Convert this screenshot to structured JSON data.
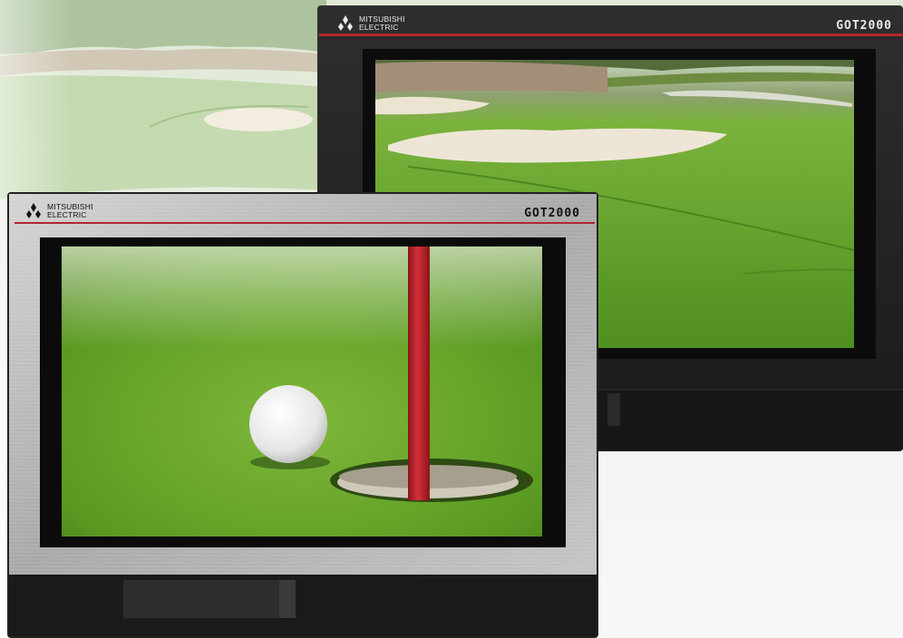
{
  "back_unit": {
    "brand_line1": "MITSUBISHI",
    "brand_line2": "ELECTRIC",
    "model": "GOT2000",
    "bezel_color": "#232323",
    "accent_stripe": "#b3262a"
  },
  "front_unit": {
    "brand_line1": "MITSUBISHI",
    "brand_line2": "ELECTRIC",
    "model": "GOT2000",
    "bezel_color": "#b8b8b8",
    "accent_stripe": "#b3262a"
  },
  "colors": {
    "grass": "#5f9a2a",
    "sand": "#e9e0cc",
    "flag_pole": "#c4242a"
  },
  "icons": [
    "mitsubishi-three-diamonds-logo"
  ]
}
